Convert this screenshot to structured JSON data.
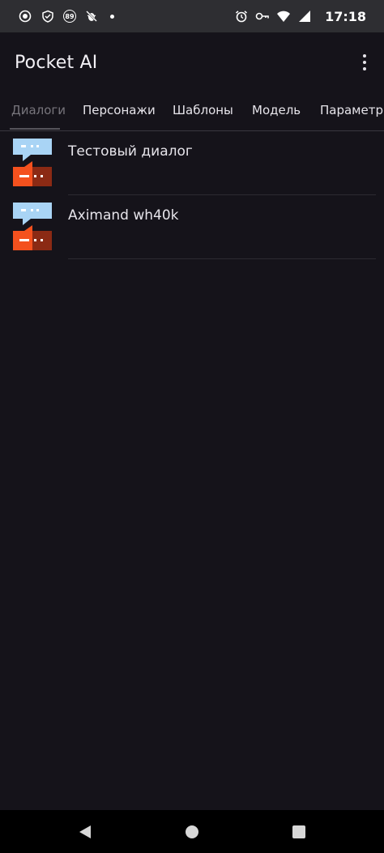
{
  "status_bar": {
    "time": "17:18",
    "badge": "89",
    "icons": [
      "record-icon",
      "shield-icon",
      "badge-89-icon",
      "bug-icon",
      "dot-icon",
      "alarm-icon",
      "key-icon",
      "wifi-icon",
      "signal-icon"
    ]
  },
  "app_bar": {
    "title": "Pocket AI",
    "overflow_icon": "more-vert-icon"
  },
  "tabs": [
    {
      "label": "Диалоги",
      "active": true
    },
    {
      "label": "Персонажи",
      "active": false
    },
    {
      "label": "Шаблоны",
      "active": false
    },
    {
      "label": "Модель",
      "active": false
    },
    {
      "label": "Параметры",
      "active": false
    }
  ],
  "dialogs": [
    {
      "title": "Тестовый диалог",
      "icon": "chat-bubbles-icon"
    },
    {
      "title": "Aximand wh40k",
      "icon": "chat-bubbles-icon"
    }
  ],
  "colors": {
    "background": "#15131a",
    "status_bar": "#2e2e32",
    "bubble_light": "#a9d4f5",
    "bubble_orange": "#f4511e",
    "bubble_dark": "#8b2a14",
    "tab_inactive": "#77757c"
  },
  "nav_bar": {
    "back_icon": "back-triangle-icon",
    "home_icon": "home-circle-icon",
    "recents_icon": "recents-square-icon"
  }
}
